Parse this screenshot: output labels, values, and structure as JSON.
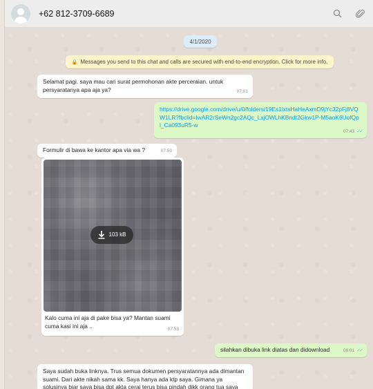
{
  "header": {
    "contact": "+62 812-3709-6689",
    "icons": [
      "avatar",
      "search-icon",
      "paperclip-icon"
    ]
  },
  "chat": {
    "date": "4/1/2020",
    "encryption_notice": "Messages you send to this chat and calls are secured with end-to-end encryption. Click for more info.",
    "messages": [
      {
        "dir": "in",
        "text": "Selamat pagi. saya mau cari surat permohonan akte perceraian. untuk persyaratanya apa aja ya?",
        "time": "07:01"
      },
      {
        "dir": "out",
        "text": "https://drive.google.com/drive/u/0/folders/19Es1lxtsHaHeAxmD9jYc32pFj8VQW1LR?fbclid=IwAR2rSeWn2gc2AQc_LxjOWLhKBndt2Gkw1P-M5aoK6UofQpl_Ca093uR5-w",
        "time": "07:43"
      },
      {
        "dir": "in",
        "text": "Formulir di bawa ke kantor apa via wa ?",
        "time": "07:50"
      },
      {
        "dir": "in",
        "type": "image",
        "size": "103 kB",
        "caption": "Kalo cuma ini aja di pake bisa ya? Mantan suami cuma kasi ini aja ..",
        "time": "07:53"
      },
      {
        "dir": "out",
        "text": "silahkan dibuka link diatas dan didownload",
        "time": "08:01"
      },
      {
        "dir": "in",
        "text": "Saya sudah buka linknya. Trus semua dokumen persyaratannya ada dimantan suami. Dari akte nikah sama kk. Saya hanya ada ktp saya. Gimana ya solusinya biar saya bisa dpt akta cerai terus bisa pindah dikk orang tua saya",
        "time": ""
      }
    ]
  },
  "colors": {
    "chat_bg": "#e5ddd5",
    "incoming": "#ffffff",
    "outgoing": "#dcf8c6",
    "link": "#039be5",
    "read_ticks": "#4fc3f7"
  }
}
